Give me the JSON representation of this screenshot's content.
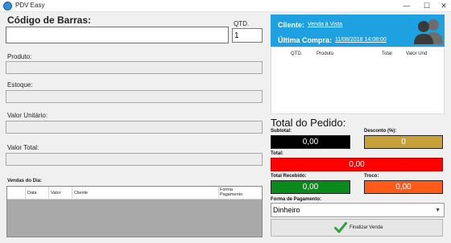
{
  "window": {
    "title": "PDV Easy",
    "minimize": "—",
    "maximize": "☐",
    "close": "✕"
  },
  "form": {
    "barcode_label": "Código de Barras:",
    "barcode_value": "",
    "qty_label": "QTD.",
    "qty_value": "1",
    "produto_label": "Produto:",
    "estoque_label": "Estoque:",
    "valor_unitario_label": "Valor Unitário:",
    "valor_total_label": "Valor Total:"
  },
  "vendas": {
    "label": "Vendas do Dia:",
    "columns": [
      "Data",
      "Valor",
      "Cliente",
      "Forma Pagamento"
    ]
  },
  "cliente": {
    "cliente_label": "Cliente:",
    "cliente_value": "Venda à Vista",
    "ultima_label": "Última Compra:",
    "ultima_value": "11/08/2018 14:08:00"
  },
  "cart": {
    "columns": [
      "QTD.",
      "Produto",
      "Total",
      "Valor Und"
    ]
  },
  "pedido": {
    "title": "Total do Pedido:",
    "subtotal_label": "Subtotal:",
    "subtotal_value": "0,00",
    "desconto_label": "Desconto (%):",
    "desconto_value": "0",
    "total_label": "Total:",
    "total_value": "0,00",
    "recebido_label": "Total Recebido:",
    "recebido_value": "0,00",
    "troco_label": "Troco:",
    "troco_value": "0,00",
    "forma_label": "Forma de Pagamento:",
    "forma_value": "Dinheiro",
    "finalizar_label": "Finalizar Venda"
  },
  "colors": {
    "accent_blue": "#1da1e0",
    "subtotal": "#000000",
    "desconto": "#c8a03a",
    "total": "#ff0000",
    "recebido": "#0a8a1a",
    "troco": "#ff5a1a"
  }
}
